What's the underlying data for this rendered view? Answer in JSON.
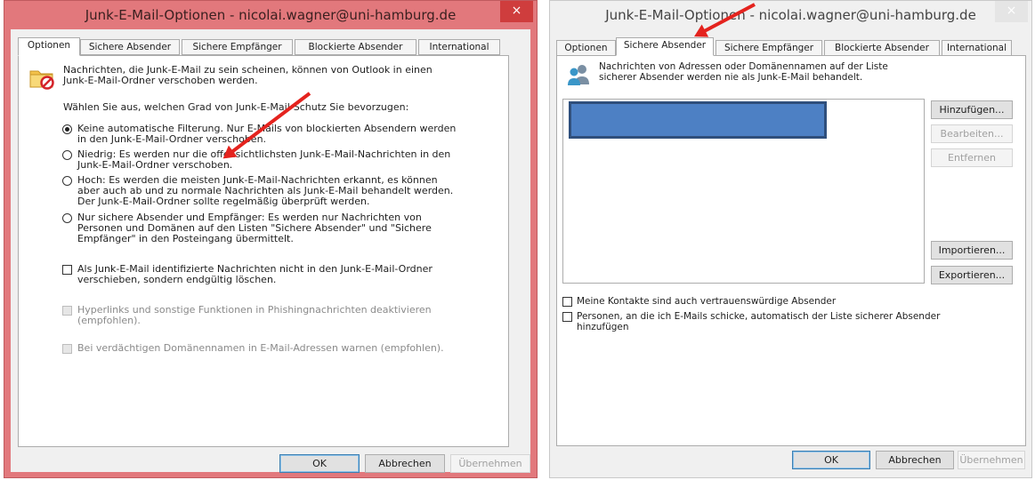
{
  "left_window": {
    "title": "Junk-E-Mail-Optionen - nicolai.wagner@uni-hamburg.de",
    "close_glyph": "×",
    "tabs": [
      "Optionen",
      "Sichere Absender",
      "Sichere Empfänger",
      "Blockierte Absender",
      "International"
    ],
    "active_tab": "Optionen",
    "intro_line1": "Nachrichten, die Junk-E-Mail zu sein scheinen, können von Outlook in einen",
    "intro_line2": "Junk-E-Mail-Ordner verschoben werden.",
    "choose_level": "Wählen Sie aus, welchen Grad von Junk-E-Mail-Schutz Sie bevorzugen:",
    "options": [
      {
        "lines": [
          "Keine automatische Filterung. Nur E-Mails von blockierten Absendern werden",
          "in den Junk-E-Mail-Ordner verschoben."
        ],
        "checked": true
      },
      {
        "lines": [
          "Niedrig: Es werden nur die offensichtlichsten Junk-E-Mail-Nachrichten in den",
          "Junk-E-Mail-Ordner verschoben."
        ],
        "checked": false
      },
      {
        "lines": [
          "Hoch: Es werden die meisten Junk-E-Mail-Nachrichten erkannt, es können",
          "aber auch ab und zu normale Nachrichten als Junk-E-Mail behandelt werden.",
          "Der Junk-E-Mail-Ordner sollte regelmäßig überprüft werden."
        ],
        "checked": false
      },
      {
        "lines": [
          "Nur sichere Absender und Empfänger: Es werden nur Nachrichten von",
          "Personen und Domänen auf den Listen \"Sichere Absender\" und \"Sichere",
          "Empfänger\" in den Posteingang übermittelt."
        ],
        "checked": false
      }
    ],
    "delete_line1": "Als Junk-E-Mail identifizierte Nachrichten nicht in den Junk-E-Mail-Ordner",
    "delete_line2": "verschieben, sondern endgültig löschen.",
    "phishing_line1": "Hyperlinks und sonstige Funktionen in Phishingnachrichten deaktivieren",
    "phishing_line2": "(empfohlen).",
    "domain_warn": "Bei verdächtigen Domänennamen in E-Mail-Adressen warnen (empfohlen).",
    "ok": "OK",
    "cancel": "Abbrechen",
    "apply": "Übernehmen"
  },
  "right_window": {
    "title": "Junk-E-Mail-Optionen - nicolai.wagner@uni-hamburg.de",
    "close_glyph": "×",
    "tabs": [
      "Optionen",
      "Sichere Absender",
      "Sichere Empfänger",
      "Blockierte Absender",
      "International"
    ],
    "active_tab": "Sichere Absender",
    "intro_line1": "Nachrichten von Adressen oder Domänennamen auf der Liste",
    "intro_line2": "sicherer Absender werden nie als Junk-E-Mail behandelt.",
    "add": "Hinzufügen...",
    "edit": "Bearbeiten...",
    "remove": "Entfernen",
    "import": "Importieren...",
    "export": "Exportieren...",
    "contacts_trusted": "Meine Kontakte sind auch vertrauenswürdige Absender",
    "auto_add_line1": "Personen, an die ich E-Mails schicke, automatisch der Liste sicherer Absender",
    "auto_add_line2": "hinzufügen",
    "ok": "OK",
    "cancel": "Abbrechen",
    "apply": "Übernehmen"
  },
  "colors": {
    "left_frame": "#e2787c",
    "close_button": "#cf3d3d",
    "annotation_arrow": "#e4231e",
    "selected_entry": "#4d80c4"
  },
  "icons": [
    "junk-folder-icon",
    "people-icon",
    "close-icon"
  ]
}
